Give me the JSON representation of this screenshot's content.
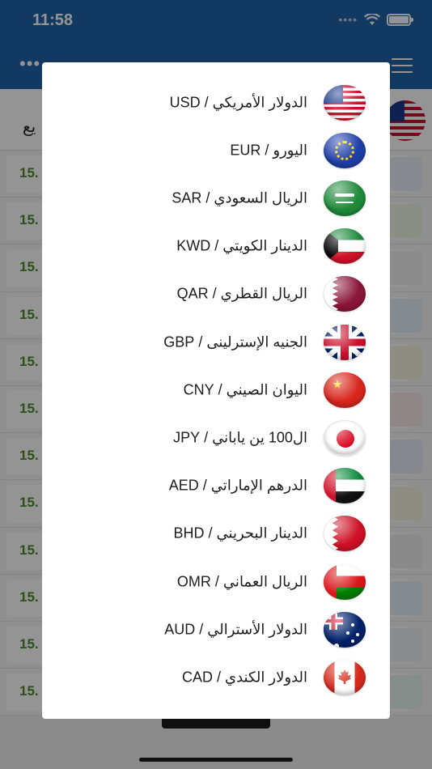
{
  "status_bar": {
    "time": "11:58"
  },
  "background": {
    "header_more": "•••",
    "subbar_text": "يع",
    "rows": [
      {
        "rate": "15."
      },
      {
        "rate": "15."
      },
      {
        "rate": "15."
      },
      {
        "rate": "15."
      },
      {
        "rate": "15."
      },
      {
        "rate": "15."
      },
      {
        "rate": "15."
      },
      {
        "rate": "15."
      },
      {
        "rate": "15."
      },
      {
        "rate": "15."
      },
      {
        "rate": "15."
      },
      {
        "rate": "15."
      }
    ]
  },
  "currencies": [
    {
      "label": "الدولار الأمريكي / USD",
      "flag": "us-flag-icon"
    },
    {
      "label": "اليورو / EUR",
      "flag": "eu-flag-icon"
    },
    {
      "label": "الريال السعودي / SAR",
      "flag": "saudi-flag-icon"
    },
    {
      "label": "الدينار الكويتي / KWD",
      "flag": "kuwait-flag-icon"
    },
    {
      "label": "الريال القطري / QAR",
      "flag": "qatar-flag-icon"
    },
    {
      "label": "الجنيه الإسترلينى / GBP",
      "flag": "uk-flag-icon"
    },
    {
      "label": "اليوان الصيني / CNY",
      "flag": "china-flag-icon"
    },
    {
      "label": "ال100 ين ياباني / JPY",
      "flag": "japan-flag-icon"
    },
    {
      "label": "الدرهم الإماراتي / AED",
      "flag": "uae-flag-icon"
    },
    {
      "label": "الدينار البحريني / BHD",
      "flag": "bahrain-flag-icon"
    },
    {
      "label": "الريال العماني / OMR",
      "flag": "oman-flag-icon"
    },
    {
      "label": "الدولار الأسترالي / AUD",
      "flag": "australia-flag-icon"
    },
    {
      "label": "الدولار الكندي / CAD",
      "flag": "canada-flag-icon"
    }
  ],
  "colors": {
    "header": "#1f63a8",
    "rate_text": "#4d8a2a"
  }
}
